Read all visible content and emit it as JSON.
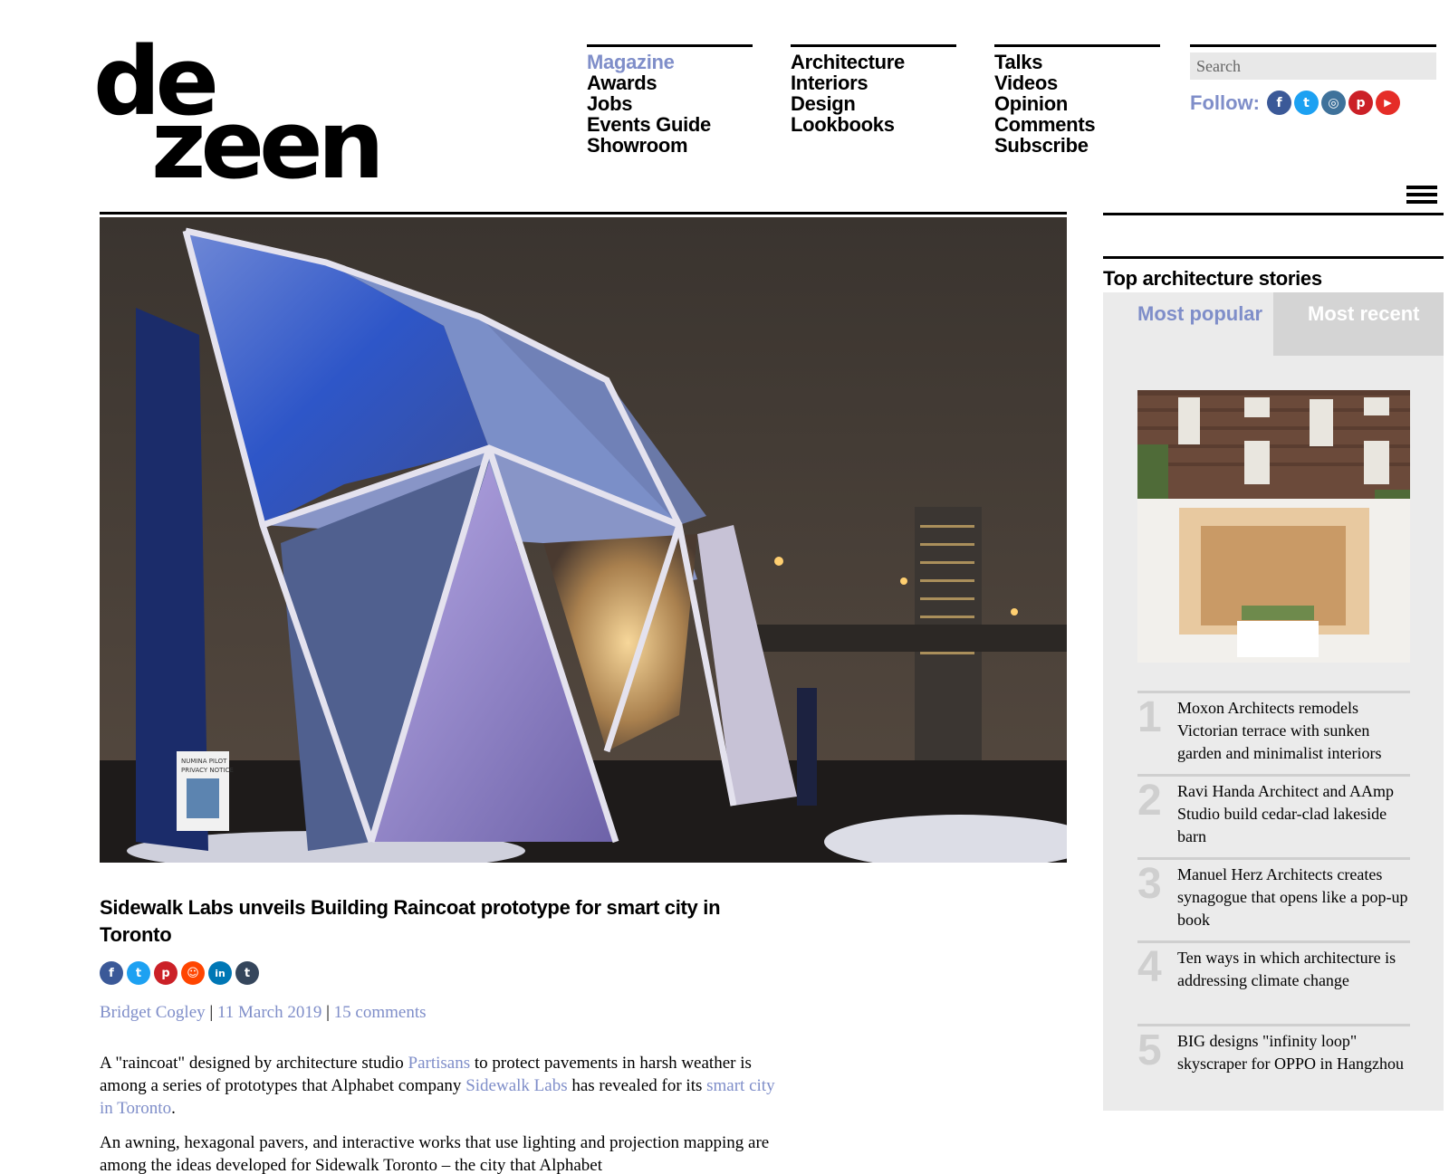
{
  "logo": {
    "line1": "de",
    "line2": "zeen"
  },
  "nav": {
    "col1": [
      "Magazine",
      "Awards",
      "Jobs",
      "Events Guide",
      "Showroom"
    ],
    "col2": [
      "Architecture",
      "Interiors",
      "Design",
      "Lookbooks"
    ],
    "col3": [
      "Talks",
      "Videos",
      "Opinion",
      "Comments",
      "Subscribe"
    ]
  },
  "search": {
    "placeholder": "Search"
  },
  "follow": {
    "label": "Follow:",
    "icons": [
      {
        "name": "facebook-icon",
        "glyph": "f",
        "color": "#3b5998"
      },
      {
        "name": "twitter-icon",
        "glyph": "t",
        "color": "#1da1f2"
      },
      {
        "name": "instagram-icon",
        "glyph": "◎",
        "color": "#3f729b"
      },
      {
        "name": "pinterest-icon",
        "glyph": "p",
        "color": "#cb2027"
      },
      {
        "name": "youtube-icon",
        "glyph": "▶",
        "color": "#e52d27"
      }
    ]
  },
  "article": {
    "title": "Sidewalk Labs unveils Building Raincoat prototype for smart city in Toronto",
    "share_icons": [
      {
        "name": "share-facebook-icon",
        "glyph": "f",
        "color": "#3b5998"
      },
      {
        "name": "share-twitter-icon",
        "glyph": "t",
        "color": "#1da1f2"
      },
      {
        "name": "share-pinterest-icon",
        "glyph": "p",
        "color": "#cb2027"
      },
      {
        "name": "share-reddit-icon",
        "glyph": "☺",
        "color": "#ff4500"
      },
      {
        "name": "share-linkedin-icon",
        "glyph": "in",
        "color": "#0077b5"
      },
      {
        "name": "share-tumblr-icon",
        "glyph": "t",
        "color": "#35465c"
      }
    ],
    "author": "Bridget Cogley",
    "sep1": " | ",
    "date": "11 March 2019",
    "sep2": " |  ",
    "comments": "15 comments",
    "p1": {
      "t1": "A \"raincoat\" designed by architecture studio ",
      "l1": "Partisans",
      "t2": " to protect pavements in harsh weather is among a series of prototypes that Alphabet company ",
      "l2": "Sidewalk Labs",
      "t3": " has revealed for its ",
      "l3": "smart city in Toronto",
      "t4": "."
    },
    "p2": "An awning, hexagonal pavers, and interactive works that use lighting and projection mapping are among the ideas developed for Sidewalk Toronto – the city that Alphabet",
    "image_sign": [
      "NUMINA PILOT",
      "PRIVACY NOTICE"
    ]
  },
  "sidebar": {
    "title": "Top architecture stories",
    "tab_popular": "Most popular",
    "tab_recent": "Most recent",
    "stories": [
      {
        "num": "1",
        "text": "Moxon Architects remodels Victorian terrace with sunken garden and minimalist interiors"
      },
      {
        "num": "2",
        "text": "Ravi Handa Architect and AAmp Studio build cedar-clad lakeside barn"
      },
      {
        "num": "3",
        "text": "Manuel Herz Architects creates synagogue that opens like a pop-up book"
      },
      {
        "num": "4",
        "text": "Ten ways in which architecture is addressing climate change"
      },
      {
        "num": "5",
        "text": "BIG designs \"infinity loop\" skyscraper for OPPO in Hangzhou"
      }
    ]
  },
  "colors": {
    "accent": "#7f8ec9",
    "rule": "#000000",
    "sidebar_bg": "#ebebeb"
  }
}
